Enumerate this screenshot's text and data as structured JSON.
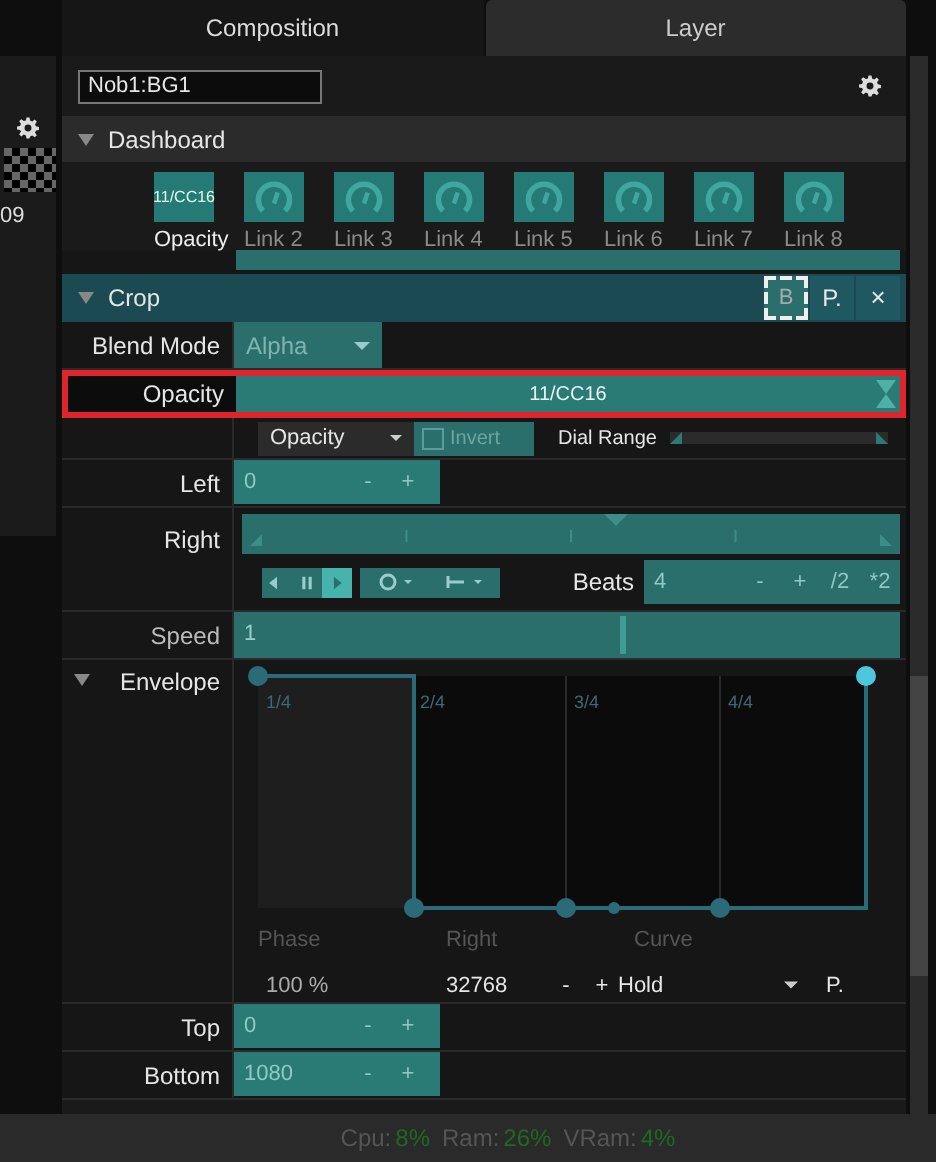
{
  "left_strip": {
    "label": "09"
  },
  "tabs": [
    {
      "label": "Composition",
      "selected": true
    },
    {
      "label": "Layer",
      "selected": false
    }
  ],
  "layer_name": {
    "value": "Nob1:BG1"
  },
  "dashboard": {
    "title": "Dashboard",
    "expanded": true,
    "dials": [
      {
        "label": "Opacity",
        "value": "11/CC16",
        "assigned": true
      },
      {
        "label": "Link 2",
        "assigned": false
      },
      {
        "label": "Link 3",
        "assigned": false
      },
      {
        "label": "Link 4",
        "assigned": false
      },
      {
        "label": "Link 5",
        "assigned": false
      },
      {
        "label": "Link 6",
        "assigned": false
      },
      {
        "label": "Link 7",
        "assigned": false
      },
      {
        "label": "Link 8",
        "assigned": false
      }
    ]
  },
  "crop": {
    "title": "Crop",
    "expanded": true,
    "bypass": {
      "label": "B",
      "selected": true
    },
    "preset": {
      "label": "P."
    },
    "remove": {
      "label": "×"
    }
  },
  "blend_mode": {
    "label": "Blend Mode",
    "value": "Alpha"
  },
  "opacity": {
    "label": "Opacity",
    "value": "11/CC16",
    "highlighted": true,
    "source": "Opacity",
    "invert": {
      "label": "Invert",
      "checked": false
    },
    "dial_range": {
      "label": "Dial Range",
      "level": 1
    }
  },
  "left": {
    "label": "Left",
    "value": "0",
    "minus": "-",
    "plus": "+"
  },
  "right": {
    "label": "Right",
    "transport": [
      {
        "kind": "back",
        "selected": false
      },
      {
        "kind": "pause",
        "selected": false
      },
      {
        "kind": "play",
        "selected": true
      }
    ],
    "beats": {
      "label": "Beats",
      "value": "4",
      "buttons": [
        "-",
        "+",
        "/2",
        "*2"
      ]
    }
  },
  "speed": {
    "label": "Speed",
    "value": "1",
    "level": 0.58
  },
  "envelope": {
    "label": "Envelope",
    "expanded": true,
    "beat_labels": [
      "1/4",
      "2/4",
      "3/4",
      "4/4"
    ],
    "phase": {
      "label": "Phase",
      "value": "100 %"
    },
    "right": {
      "label": "Right",
      "value": "32768",
      "minus": "-",
      "plus": "+"
    },
    "curve": {
      "label": "Curve",
      "value": "Hold",
      "preset": "P."
    }
  },
  "top": {
    "label": "Top",
    "value": "0",
    "minus": "-",
    "plus": "+"
  },
  "bottom": {
    "label": "Bottom",
    "value": "1080",
    "minus": "-",
    "plus": "+"
  },
  "status_bar": [
    {
      "label": "Cpu:",
      "value": "8%"
    },
    {
      "label": "Ram:",
      "value": "26%"
    },
    {
      "label": "VRam:",
      "value": "4%"
    }
  ]
}
